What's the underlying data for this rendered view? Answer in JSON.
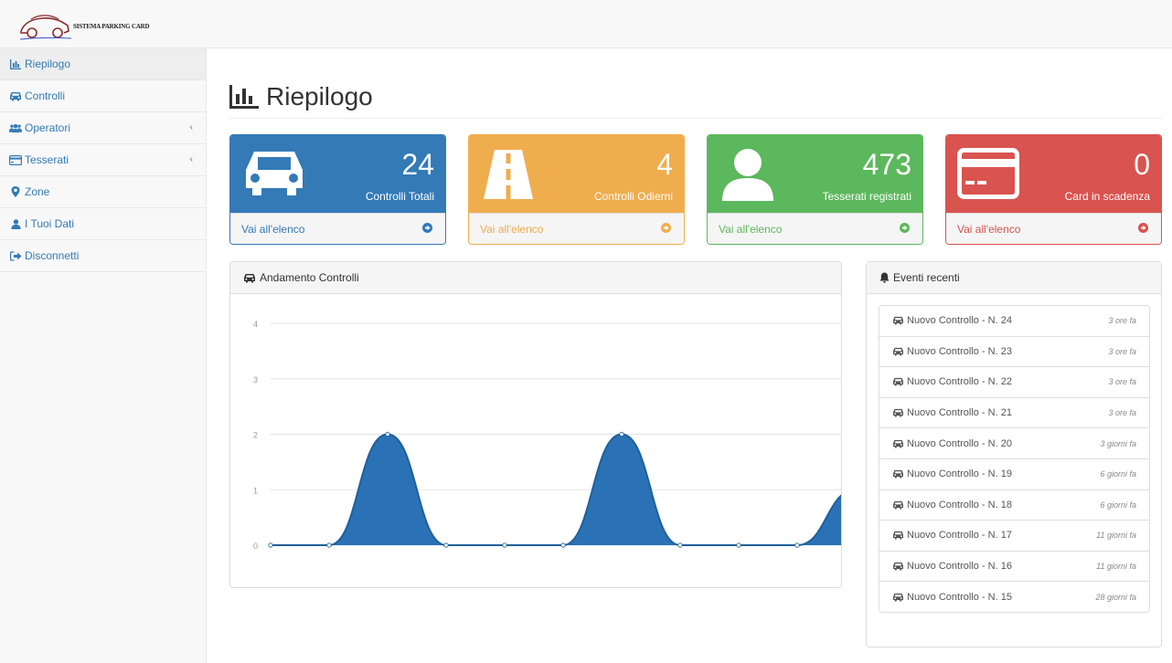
{
  "app": {
    "logo_text": "SISTEMA PARKING CARD"
  },
  "sidebar": {
    "items": [
      {
        "label": "Riepilogo",
        "icon": "bar-chart-icon"
      },
      {
        "label": "Controlli",
        "icon": "car-icon"
      },
      {
        "label": "Operatori",
        "icon": "users-icon"
      },
      {
        "label": "Tesserati",
        "icon": "credit-card-icon"
      },
      {
        "label": "Zone",
        "icon": "map-marker-icon"
      },
      {
        "label": "I Tuoi Dati",
        "icon": "user-icon"
      },
      {
        "label": "Disconnetti",
        "icon": "sign-out-icon"
      }
    ],
    "expand_arrow": "‹"
  },
  "page": {
    "title": "Riepilogo"
  },
  "cards": [
    {
      "value": "24",
      "label": "Controlli Totali",
      "link": "Vai all'elenco",
      "color": "#337ab7",
      "icon": "car-icon"
    },
    {
      "value": "4",
      "label": "Controlli Odierni",
      "link": "Vai all'elenco",
      "color": "#f0ad4e",
      "icon": "road-icon"
    },
    {
      "value": "473",
      "label": "Tesserati registrati",
      "link": "Vai all'elenco",
      "color": "#5cb85c",
      "icon": "user-icon"
    },
    {
      "value": "0",
      "label": "Card in scadenza",
      "link": "Vai all'elenco",
      "color": "#d9534f",
      "icon": "credit-card-icon"
    }
  ],
  "chart_panel": {
    "title": "Andamento Controlli"
  },
  "chart_data": {
    "type": "area",
    "title": "Andamento Controlli",
    "xlabel": "",
    "ylabel": "",
    "ylim": [
      0,
      4
    ],
    "yticks": [
      0,
      1,
      2,
      3,
      4
    ],
    "values": [
      0,
      0,
      2,
      0,
      0,
      0,
      2,
      0,
      0,
      0,
      1
    ],
    "color": "#2a72b5",
    "grid": true
  },
  "events_panel": {
    "title": "Eventi recenti",
    "items": [
      {
        "label": "Nuovo Controllo - N. 24",
        "time": "3 ore fa"
      },
      {
        "label": "Nuovo Controllo - N. 23",
        "time": "3 ore fa"
      },
      {
        "label": "Nuovo Controllo - N. 22",
        "time": "3 ore fa"
      },
      {
        "label": "Nuovo Controllo - N. 21",
        "time": "3 ore fa"
      },
      {
        "label": "Nuovo Controllo - N. 20",
        "time": "3 giorni fa"
      },
      {
        "label": "Nuovo Controllo - N. 19",
        "time": "6 giorni fa"
      },
      {
        "label": "Nuovo Controllo - N. 18",
        "time": "6 giorni fa"
      },
      {
        "label": "Nuovo Controllo - N. 17",
        "time": "11 giorni fa"
      },
      {
        "label": "Nuovo Controllo - N. 16",
        "time": "11 giorni fa"
      },
      {
        "label": "Nuovo Controllo - N. 15",
        "time": "28 giorni fa"
      }
    ]
  }
}
